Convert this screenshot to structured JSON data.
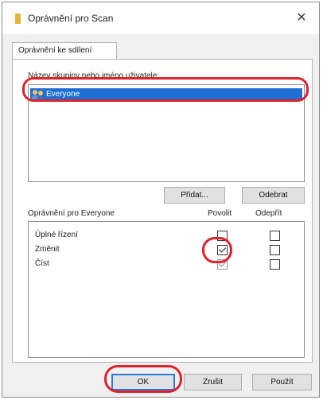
{
  "window": {
    "title": "Oprávnění pro Scan",
    "close_glyph": "✕"
  },
  "tab": {
    "label": "Oprávnění ke sdílení"
  },
  "users": {
    "label": "Název skupiny nebo jméno uživatele:",
    "items": [
      {
        "name": "Everyone",
        "icon": "users-icon",
        "selected": true
      }
    ],
    "add_label": "Přidat...",
    "remove_label": "Odebrat"
  },
  "permissions": {
    "label": "Oprávnění pro Everyone",
    "col_allow": "Povolit",
    "col_deny": "Odepřít",
    "rows": [
      {
        "name": "Úplné řízení",
        "allow": false,
        "deny": false
      },
      {
        "name": "Změnit",
        "allow": true,
        "deny": false
      },
      {
        "name": "Číst",
        "allow": true,
        "deny": false,
        "allow_disabled": true
      }
    ]
  },
  "buttons": {
    "ok": "OK",
    "cancel": "Zrušit",
    "apply": "Použít"
  },
  "colors": {
    "highlight": "#e0212a",
    "selection": "#1d6fd4",
    "folder_icon": "#e8b33a"
  }
}
